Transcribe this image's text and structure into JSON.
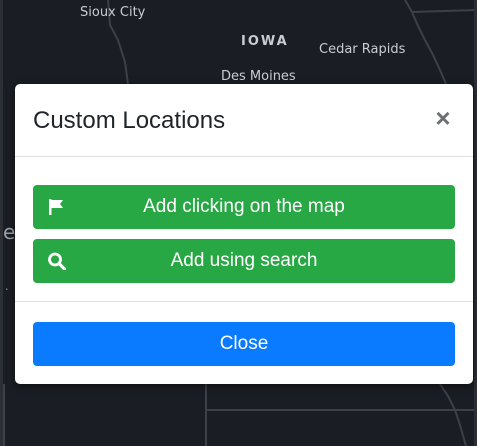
{
  "map": {
    "labels": {
      "sioux_city": "Sioux City",
      "iowa": "IOWA",
      "cedar_rapids": "Cedar Rapids",
      "des_moines": "Des Moines",
      "edge_fragment": "e",
      "dot_fragment": "."
    },
    "colors": {
      "background": "#1a1d23",
      "boundary": "#3c4048"
    }
  },
  "modal": {
    "title": "Custom Locations",
    "close_symbol": "×",
    "buttons": {
      "add_map": {
        "label": "Add clicking on the map",
        "icon": "flag-icon",
        "color": "#28a745"
      },
      "add_search": {
        "label": "Add using search",
        "icon": "search-icon",
        "color": "#28a745"
      },
      "close": {
        "label": "Close",
        "color": "#0a7bff"
      }
    }
  }
}
